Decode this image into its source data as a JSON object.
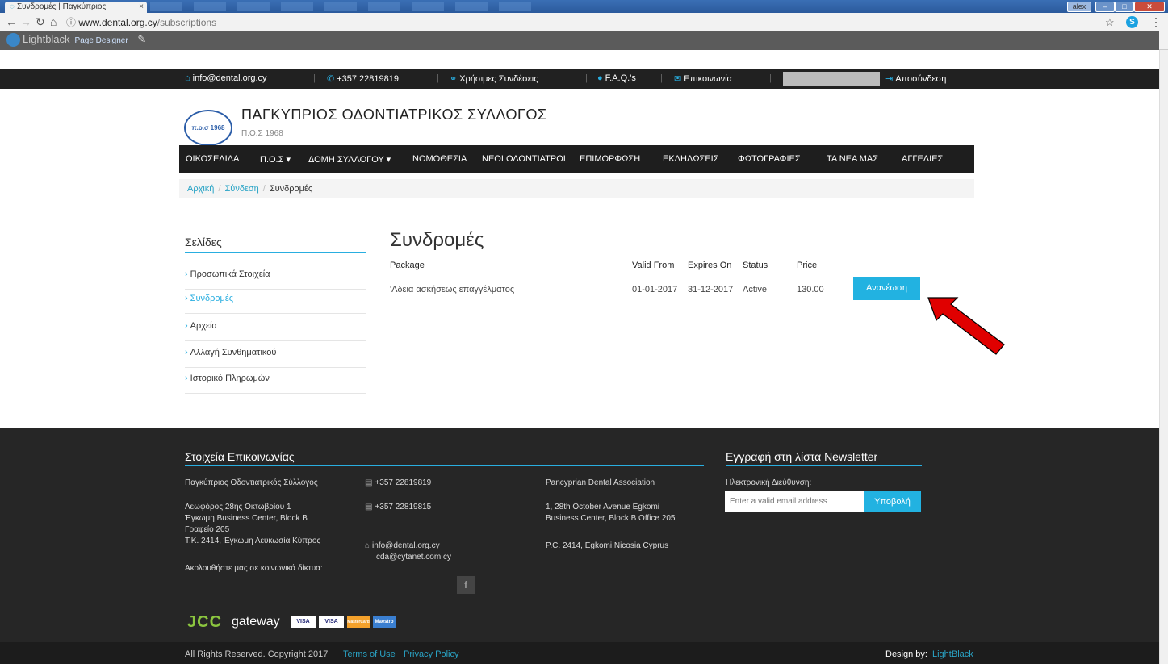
{
  "browser": {
    "tab_title": "Συνδρομές | Παγκύπριος",
    "tab_close": "×",
    "user_badge": "alex",
    "url_host": "www.dental.org.cy",
    "url_path": "/subscriptions",
    "designer_brand": "Lightblack",
    "designer_label": "Page Designer"
  },
  "topbar": {
    "email": "info@dental.org.cy",
    "phone": "+357 22819819",
    "links": "Χρήσιμες Συνδέσεις",
    "faq": "F.A.Q.'s",
    "contact": "Επικοινωνία",
    "logout": "Αποσύνδεση"
  },
  "header": {
    "logo_text": "π.ο.σ 1968",
    "title": "ΠΑΓΚΥΠΡΙΟΣ ΟΔΟΝΤΙΑΤΡΙΚΟΣ ΣΥΛΛΟΓΟΣ",
    "subtitle": "Π.Ο.Σ 1968"
  },
  "nav": {
    "items": [
      "ΟΙΚΟΣΕΛΙΔΑ",
      "Π.Ο.Σ ▾",
      "ΔΟΜΗ ΣΥΛΛΟΓΟΥ ▾",
      "ΝΟΜΟΘΕΣΙΑ",
      "ΝΕΟΙ ΟΔΟΝΤΙΑΤΡΟΙ",
      "ΕΠΙΜΟΡΦΩΣΗ",
      "ΕΚΔΗΛΩΣΕΙΣ",
      "ΦΩΤΟΓΡΑΦΙΕΣ",
      "ΤΑ ΝΕΑ ΜΑΣ",
      "ΑΓΓΕΛΙΕΣ"
    ]
  },
  "breadcrumb": {
    "home": "Αρχική",
    "login": "Σύνδεση",
    "current": "Συνδρομές",
    "separator": "/"
  },
  "sidebar": {
    "title": "Σελίδες",
    "items": [
      "Προσωπικά Στοιχεία",
      "Συνδρομές",
      "Αρχεία",
      "Αλλαγή Συνθηματικού",
      "Ιστορικό Πληρωμών"
    ],
    "active_index": 1
  },
  "main": {
    "title": "Συνδρομές",
    "columns": [
      "Package",
      "Valid From",
      "Expires On",
      "Status",
      "Price"
    ],
    "rows": [
      {
        "package": "'Αδεια ασκήσεως επαγγέλματος",
        "valid_from": "01-01-2017",
        "expires_on": "31-12-2017",
        "status": "Active",
        "price": "130.00",
        "action": "Ανανέωση"
      }
    ]
  },
  "footer": {
    "contact_title": "Στοιχεία Επικοινωνίας",
    "org_name_gr": "Παγκύπριος Οδοντιατρικός Σύλλογος",
    "address_gr_1": "Λεωφόρος 28ης Οκτωβρίου 1",
    "address_gr_2": "Έγκωμη Business Center, Block B",
    "address_gr_3": "Γραφείο 205",
    "address_gr_4": "Τ.Κ. 2414, Έγκωμη Λευκωσία Κύπρος",
    "phone_1": "+357 22819819",
    "phone_2": "+357 22819815",
    "email_1": "info@dental.org.cy",
    "email_2": "cda@cytanet.com.cy",
    "org_name_en": "Pancyprian Dental Association",
    "address_en_1": "1, 28th October Avenue Egkomi",
    "address_en_2": "Business Center, Block B Office 205",
    "address_en_3": "P.C. 2414, Egkomi Nicosia Cyprus",
    "social_label": "Ακολουθήστε μας σε κοινωνικά δίκτυα:",
    "newsletter_title": "Εγγραφή στη λίστα Newsletter",
    "email_label": "Ηλεκτρονική Διεύθυνση:",
    "email_placeholder": "Enter a valid email address",
    "submit": "Υποβολή",
    "jcc": "JCC",
    "gateway": "gateway",
    "cards": [
      "VISA",
      "VISA",
      "MasterCard",
      "Maestro"
    ]
  },
  "bottombar": {
    "copyright": "All Rights Reserved. Copyright 2017",
    "terms": "Terms of Use",
    "privacy": "Privacy Policy",
    "design_by": "Design by:",
    "designer": "LightBlack"
  },
  "colors": {
    "accent": "#22b2e1",
    "dark": "#1e1e1e",
    "arrow": "#e00000"
  }
}
